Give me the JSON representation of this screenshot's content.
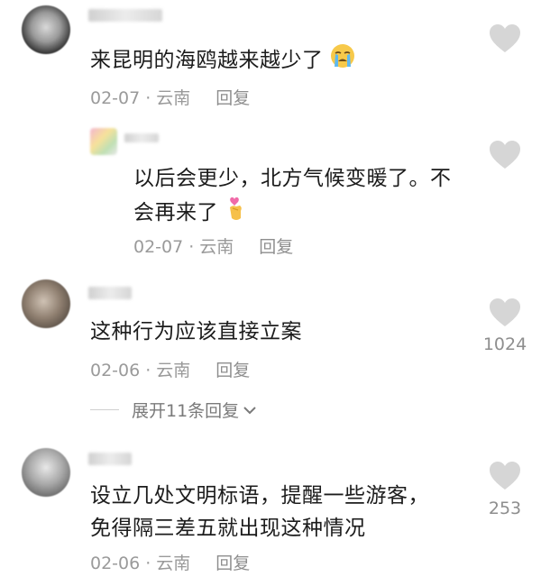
{
  "comments": [
    {
      "text": "来昆明的海鸥越来越少了",
      "emoji": "loudly-crying-face",
      "date": "02-07",
      "location": "云南",
      "reply": "回复",
      "likes": ""
    },
    {
      "text_line1": "以后会更少，北方气候变暖了。不",
      "text_line2": "会再来了",
      "emoji": "finger-heart",
      "date": "02-07",
      "location": "云南",
      "reply": "回复",
      "likes": ""
    },
    {
      "text": "这种行为应该直接立案",
      "date": "02-06",
      "location": "云南",
      "reply": "回复",
      "likes": "1024"
    },
    {
      "text_line1": "设立几处文明标语，提醒一些游客，",
      "text_line2": "免得隔三差五就出现这种情况",
      "date": "02-06",
      "location": "云南",
      "reply": "回复",
      "likes": "253"
    }
  ],
  "expand_replies": "展开11条回复",
  "dot": "·",
  "colors": {
    "text": "#1c1c1c",
    "meta": "#9a9a9a",
    "heart": "#d6d6d6"
  }
}
